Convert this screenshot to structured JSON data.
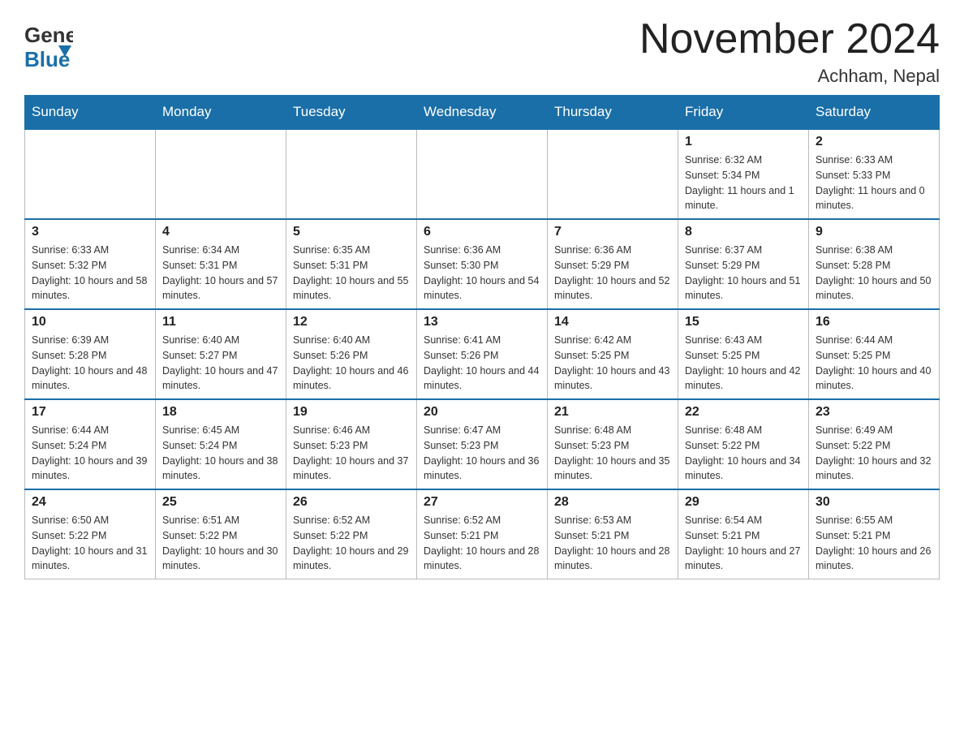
{
  "header": {
    "logo_general": "General",
    "logo_blue": "Blue",
    "month_title": "November 2024",
    "location": "Achham, Nepal"
  },
  "weekdays": [
    "Sunday",
    "Monday",
    "Tuesday",
    "Wednesday",
    "Thursday",
    "Friday",
    "Saturday"
  ],
  "weeks": [
    [
      {
        "day": "",
        "info": ""
      },
      {
        "day": "",
        "info": ""
      },
      {
        "day": "",
        "info": ""
      },
      {
        "day": "",
        "info": ""
      },
      {
        "day": "",
        "info": ""
      },
      {
        "day": "1",
        "info": "Sunrise: 6:32 AM\nSunset: 5:34 PM\nDaylight: 11 hours and 1 minute."
      },
      {
        "day": "2",
        "info": "Sunrise: 6:33 AM\nSunset: 5:33 PM\nDaylight: 11 hours and 0 minutes."
      }
    ],
    [
      {
        "day": "3",
        "info": "Sunrise: 6:33 AM\nSunset: 5:32 PM\nDaylight: 10 hours and 58 minutes."
      },
      {
        "day": "4",
        "info": "Sunrise: 6:34 AM\nSunset: 5:31 PM\nDaylight: 10 hours and 57 minutes."
      },
      {
        "day": "5",
        "info": "Sunrise: 6:35 AM\nSunset: 5:31 PM\nDaylight: 10 hours and 55 minutes."
      },
      {
        "day": "6",
        "info": "Sunrise: 6:36 AM\nSunset: 5:30 PM\nDaylight: 10 hours and 54 minutes."
      },
      {
        "day": "7",
        "info": "Sunrise: 6:36 AM\nSunset: 5:29 PM\nDaylight: 10 hours and 52 minutes."
      },
      {
        "day": "8",
        "info": "Sunrise: 6:37 AM\nSunset: 5:29 PM\nDaylight: 10 hours and 51 minutes."
      },
      {
        "day": "9",
        "info": "Sunrise: 6:38 AM\nSunset: 5:28 PM\nDaylight: 10 hours and 50 minutes."
      }
    ],
    [
      {
        "day": "10",
        "info": "Sunrise: 6:39 AM\nSunset: 5:28 PM\nDaylight: 10 hours and 48 minutes."
      },
      {
        "day": "11",
        "info": "Sunrise: 6:40 AM\nSunset: 5:27 PM\nDaylight: 10 hours and 47 minutes."
      },
      {
        "day": "12",
        "info": "Sunrise: 6:40 AM\nSunset: 5:26 PM\nDaylight: 10 hours and 46 minutes."
      },
      {
        "day": "13",
        "info": "Sunrise: 6:41 AM\nSunset: 5:26 PM\nDaylight: 10 hours and 44 minutes."
      },
      {
        "day": "14",
        "info": "Sunrise: 6:42 AM\nSunset: 5:25 PM\nDaylight: 10 hours and 43 minutes."
      },
      {
        "day": "15",
        "info": "Sunrise: 6:43 AM\nSunset: 5:25 PM\nDaylight: 10 hours and 42 minutes."
      },
      {
        "day": "16",
        "info": "Sunrise: 6:44 AM\nSunset: 5:25 PM\nDaylight: 10 hours and 40 minutes."
      }
    ],
    [
      {
        "day": "17",
        "info": "Sunrise: 6:44 AM\nSunset: 5:24 PM\nDaylight: 10 hours and 39 minutes."
      },
      {
        "day": "18",
        "info": "Sunrise: 6:45 AM\nSunset: 5:24 PM\nDaylight: 10 hours and 38 minutes."
      },
      {
        "day": "19",
        "info": "Sunrise: 6:46 AM\nSunset: 5:23 PM\nDaylight: 10 hours and 37 minutes."
      },
      {
        "day": "20",
        "info": "Sunrise: 6:47 AM\nSunset: 5:23 PM\nDaylight: 10 hours and 36 minutes."
      },
      {
        "day": "21",
        "info": "Sunrise: 6:48 AM\nSunset: 5:23 PM\nDaylight: 10 hours and 35 minutes."
      },
      {
        "day": "22",
        "info": "Sunrise: 6:48 AM\nSunset: 5:22 PM\nDaylight: 10 hours and 34 minutes."
      },
      {
        "day": "23",
        "info": "Sunrise: 6:49 AM\nSunset: 5:22 PM\nDaylight: 10 hours and 32 minutes."
      }
    ],
    [
      {
        "day": "24",
        "info": "Sunrise: 6:50 AM\nSunset: 5:22 PM\nDaylight: 10 hours and 31 minutes."
      },
      {
        "day": "25",
        "info": "Sunrise: 6:51 AM\nSunset: 5:22 PM\nDaylight: 10 hours and 30 minutes."
      },
      {
        "day": "26",
        "info": "Sunrise: 6:52 AM\nSunset: 5:22 PM\nDaylight: 10 hours and 29 minutes."
      },
      {
        "day": "27",
        "info": "Sunrise: 6:52 AM\nSunset: 5:21 PM\nDaylight: 10 hours and 28 minutes."
      },
      {
        "day": "28",
        "info": "Sunrise: 6:53 AM\nSunset: 5:21 PM\nDaylight: 10 hours and 28 minutes."
      },
      {
        "day": "29",
        "info": "Sunrise: 6:54 AM\nSunset: 5:21 PM\nDaylight: 10 hours and 27 minutes."
      },
      {
        "day": "30",
        "info": "Sunrise: 6:55 AM\nSunset: 5:21 PM\nDaylight: 10 hours and 26 minutes."
      }
    ]
  ]
}
